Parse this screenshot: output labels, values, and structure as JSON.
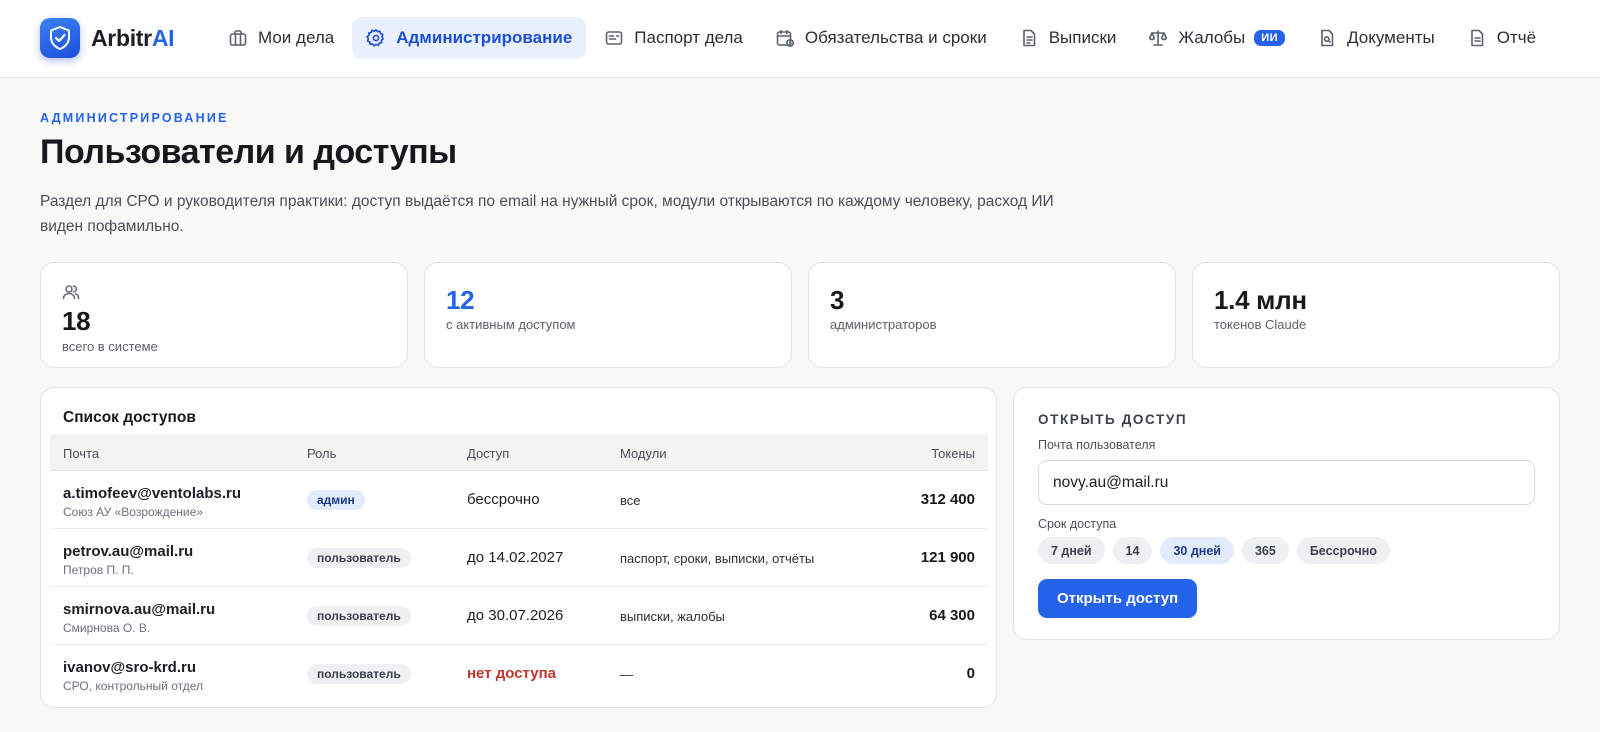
{
  "app": {
    "logo_text": "Arbitr",
    "logo_accent": "AI",
    "brand_color": "#2563eb"
  },
  "nav": [
    {
      "label": "Мои дела",
      "icon": "briefcase-icon",
      "active": false
    },
    {
      "label": "Администрирование",
      "icon": "gear-icon",
      "active": true
    },
    {
      "label": "Паспорт дела",
      "icon": "id-card-icon",
      "active": false
    },
    {
      "label": "Обязательства и сроки",
      "icon": "calendar-icon",
      "active": false
    },
    {
      "label": "Выписки",
      "icon": "statement-icon",
      "active": false
    },
    {
      "label": "Жалобы",
      "icon": "scales-icon",
      "active": false,
      "badge": "ИИ"
    },
    {
      "label": "Документы",
      "icon": "document-search-icon",
      "active": false
    },
    {
      "label": "Отчё",
      "icon": "report-icon",
      "active": false
    }
  ],
  "header": {
    "eyebrow": "АДМИНИСТРИРОВАНИЕ",
    "title": "Пользователи и доступы",
    "description": "Раздел для СРО и руководителя практики: доступ выдаётся по email на нужный срок, модули открываются по каждому человеку, расход ИИ виден пофамильно."
  },
  "stats": [
    {
      "value": "18",
      "label": "всего в системе",
      "icon": "users-icon"
    },
    {
      "value": "12",
      "label": "с активным доступом"
    },
    {
      "value": "3",
      "label": "администраторов"
    },
    {
      "value": "1.4 млн",
      "label": "токенов Claude"
    }
  ],
  "access_list": {
    "title": "Список доступов",
    "columns": [
      "Почта",
      "Роль",
      "Доступ",
      "Модули",
      "Токены"
    ],
    "rows": [
      {
        "email": "a.timofeev@ventolabs.ru",
        "org": "Союз АУ «Возрождение»",
        "role": "админ",
        "access": "бессрочно",
        "modules": "все",
        "tokens": "312 400"
      },
      {
        "email": "petrov.au@mail.ru",
        "org": "Петров П. П.",
        "role": "пользователь",
        "access": "до 14.02.2027",
        "modules": "паспорт, сроки, выписки, отчёты",
        "tokens": "121 900"
      },
      {
        "email": "smirnova.au@mail.ru",
        "org": "Смирнова О. В.",
        "role": "пользователь",
        "access": "до 30.07.2026",
        "modules": "выписки, жалобы",
        "tokens": "64 300"
      },
      {
        "email": "ivanov@sro-krd.ru",
        "org": "СРО, контрольный отдел",
        "role": "пользователь",
        "access": "нет доступа",
        "modules": "—",
        "tokens": "0"
      }
    ]
  },
  "open_access": {
    "title": "ОТКРЫТЬ ДОСТУП",
    "email_label": "Почта пользователя",
    "email_value": "novy.au@mail.ru",
    "term_label": "Срок доступа",
    "terms": [
      "7 дней",
      "14",
      "30 дней",
      "365",
      "Бессрочно"
    ],
    "selected_term": "30 дней",
    "submit_label": "Открыть доступ"
  }
}
